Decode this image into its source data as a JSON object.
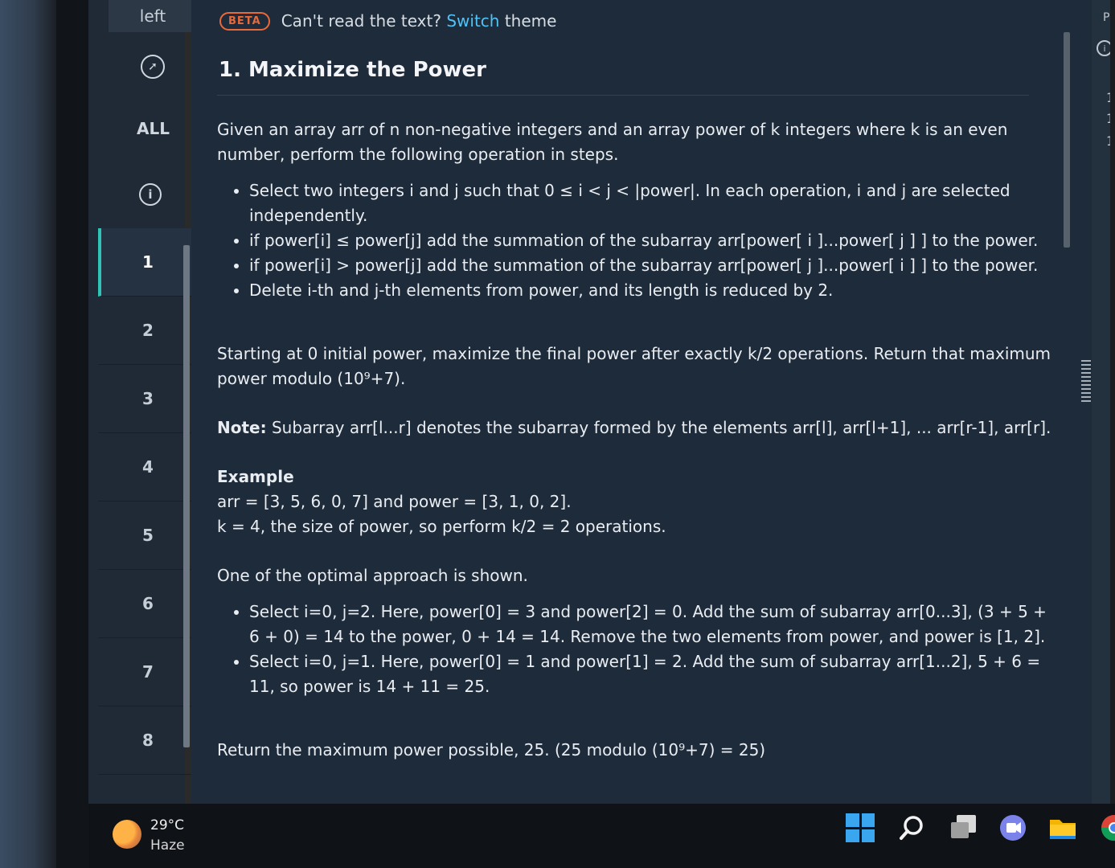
{
  "nav": {
    "top_tab": "left",
    "all_label": "ALL",
    "questions": [
      "1",
      "2",
      "3",
      "4",
      "5",
      "6",
      "7",
      "8"
    ]
  },
  "banner": {
    "badge": "BETA",
    "prefix": "Can't read the text?",
    "link": "Switch",
    "suffix": "theme"
  },
  "problem": {
    "title": "1. Maximize the Power",
    "intro": "Given an array arr of n non-negative integers and an array power of k integers where k is an even number, perform the following operation in steps.",
    "steps": [
      "Select two integers i and j such that 0 ≤ i < j < |power|. In each operation, i and j are selected independently.",
      "if power[i] ≤ power[j] add the summation of the subarray arr[power[ i ]...power[ j ] ] to the power.",
      "if power[i] > power[j] add the summation of the subarray arr[power[ j ]...power[ i ] ] to the power.",
      "Delete i-th and j-th elements from power, and its length is reduced by 2."
    ],
    "objective": "Starting at 0 initial power, maximize the final power after exactly k/2 operations. Return that maximum power modulo (10⁹+7).",
    "note_label": "Note:",
    "note": "Subarray arr[l...r] denotes the subarray formed by the elements arr[l], arr[l+1], ... arr[r-1], arr[r].",
    "example_label": "Example",
    "example_line1": "arr = [3, 5, 6, 0, 7] and power = [3, 1, 0, 2].",
    "example_line2": "k = 4, the size of power, so perform k/2 = 2 operations.",
    "approach": "One of the optimal approach is shown.",
    "approach_steps": [
      "Select i=0, j=2. Here, power[0] = 3 and power[2] = 0. Add the sum of subarray arr[0...3], (3 + 5 + 6 + 0) = 14 to the power, 0 + 14 = 14. Remove the two elements from power, and power is [1, 2].",
      "Select i=0, j=1. Here, power[0] = 1 and power[1] = 2. Add the sum of subarray arr[1...2], 5 + 6 = 11, so power is 14 + 11 = 25."
    ],
    "result": "Return the maximum power possible, 25. (25 modulo (10⁹+7) = 25)"
  },
  "right_panel": {
    "letter": "P",
    "lines": [
      "1",
      "1",
      "1"
    ]
  },
  "taskbar": {
    "temperature": "29°C",
    "condition": "Haze"
  },
  "colors": {
    "accent": "#2ec4b6",
    "link": "#4fc3f7",
    "beta": "#e8693a",
    "panel": "#1e2b3a"
  }
}
